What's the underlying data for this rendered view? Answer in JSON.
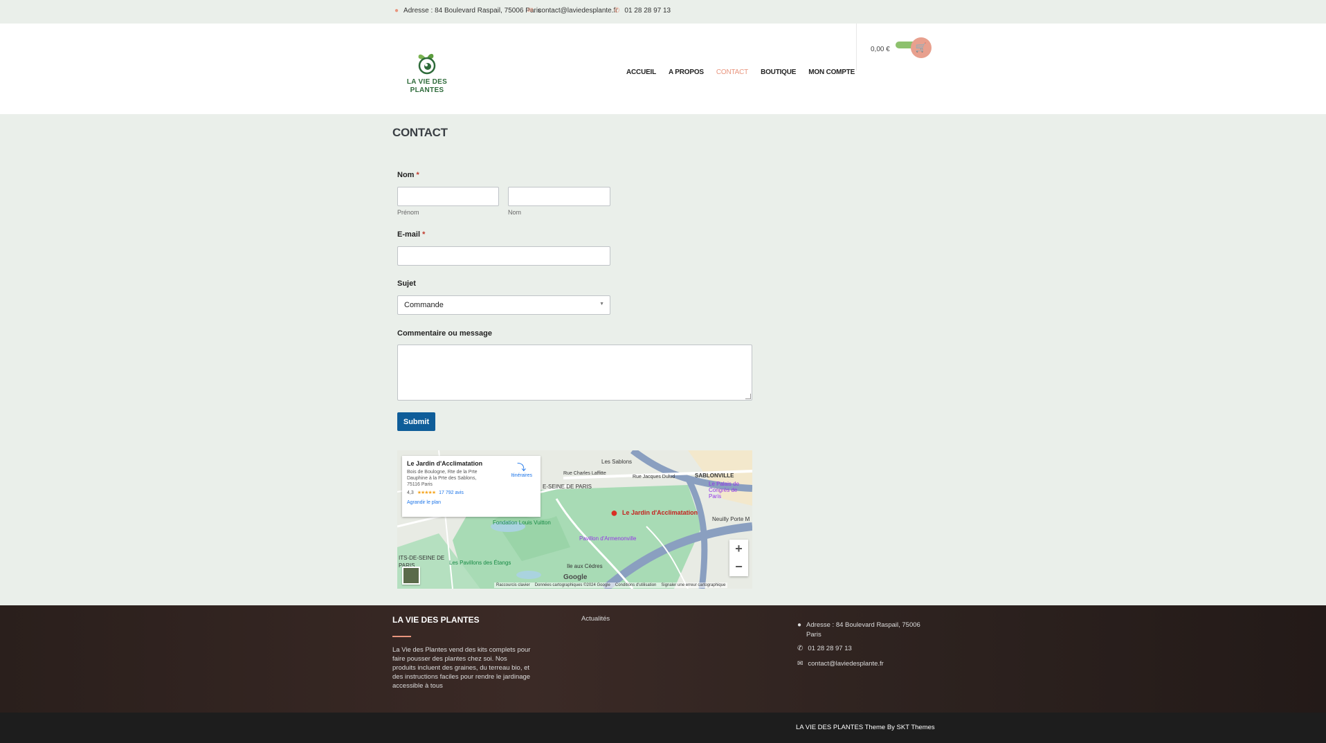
{
  "topbar": {
    "address": "Adresse : 84 Boulevard Raspail, 75006 Paris",
    "email": "contact@laviedesplante.fr",
    "phone": "01 28 28 97 13"
  },
  "header": {
    "logo_line1": "LA VIE DES",
    "logo_line2": "PLANTES",
    "nav": [
      "ACCUEIL",
      "A PROPOS",
      "CONTACT",
      "BOUTIQUE",
      "MON COMPTE"
    ],
    "cart_total": "0,00 €"
  },
  "page": {
    "title": "CONTACT"
  },
  "form": {
    "name_label": "Nom",
    "required_mark": "*",
    "first_name_sublabel": "Prénom",
    "last_name_sublabel": "Nom",
    "email_label": "E-mail",
    "subject_label": "Sujet",
    "subject_value": "Commande",
    "message_label": "Commentaire ou message",
    "submit_label": "Submit"
  },
  "map": {
    "place_name": "Le Jardin d'Acclimatation",
    "place_address": "Bois de Boulogne, Rte de la Prte Dauphine à la Prte des Sablons, 75116 Paris",
    "rating": "4,3",
    "stars": "★★★★★",
    "reviews": "17 792 avis",
    "directions_label": "Itinéraires",
    "enlarge_label": "Agrandir le plan",
    "pin_label": "Le Jardin d'Acclimatation",
    "labels": {
      "les_sablons": "Les Sablons",
      "sablonville": "SABLONVILLE",
      "palais": "Le Palais de Congrès de Paris",
      "fondation": "Fondation Louis Vuitton",
      "pavillon": "Pavillon d'Armenonville",
      "neuilly": "Neuilly Porte M",
      "pavillons_etangs": "Les Pavillons des Étangs",
      "ile_cedres": "Ile aux Cèdres",
      "paris1": "E-SEINE DE PARIS",
      "paris2": "ITS-DE-SEINE DE PARIS",
      "rue_laffitte": "Rue Charles Laffitte",
      "rue_dulud": "Rue Jacques Dulud",
      "google": "Google"
    },
    "footer": [
      "Raccourcis clavier",
      "Données cartographiques ©2024 Google",
      "Conditions d'utilisation",
      "Signaler une erreur cartographique"
    ]
  },
  "footer": {
    "title": "LA VIE DES PLANTES",
    "description": "La Vie des Plantes vend des kits complets pour faire pousser des plantes chez soi. Nos produits incluent des graines, du terreau bio, et des instructions faciles pour rendre le jardinage accessible à tous",
    "news_label": "Actualités",
    "address": "Adresse : 84 Boulevard Raspail, 75006 Paris",
    "phone": "01 28 28 97 13",
    "email": "contact@laviedesplante.fr",
    "copyright": "LA VIE DES PLANTES Theme By SKT Themes"
  },
  "colors": {
    "accent": "#e8957e",
    "button": "#0f5d99",
    "footer_bg": "#2d221f",
    "page_bg": "#eaefea"
  }
}
